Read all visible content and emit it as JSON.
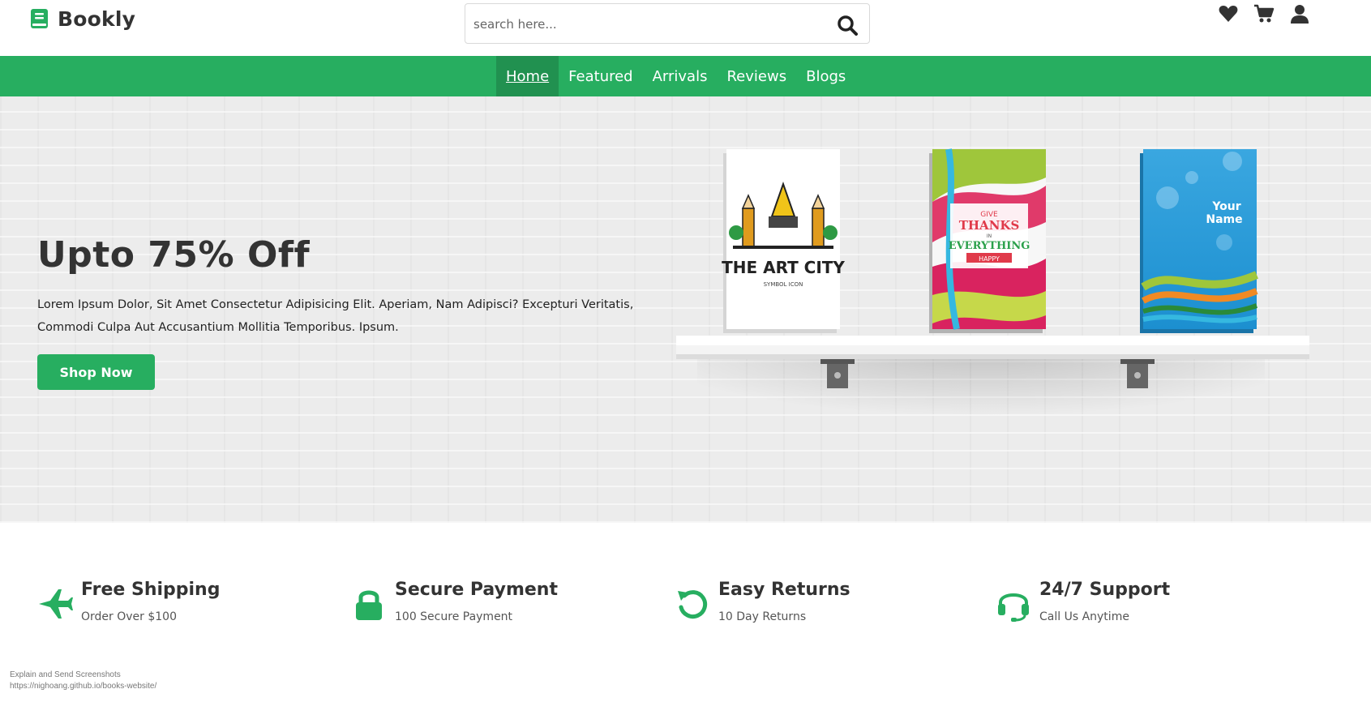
{
  "header": {
    "brand": "Bookly",
    "search_placeholder": "search here...",
    "colors": {
      "accent": "#27ae60",
      "text": "#333333"
    },
    "icons": [
      "heart-icon",
      "cart-icon",
      "user-icon"
    ]
  },
  "nav": {
    "items": [
      {
        "label": "Home",
        "active": true
      },
      {
        "label": "Featured",
        "active": false
      },
      {
        "label": "Arrivals",
        "active": false
      },
      {
        "label": "Reviews",
        "active": false
      },
      {
        "label": "Blogs",
        "active": false
      }
    ]
  },
  "hero": {
    "title": "Upto 75% Off",
    "description": "Lorem Ipsum Dolor, Sit Amet Consectetur Adipisicing Elit. Aperiam, Nam Adipisci? Excepturi Veritatis, Commodi Culpa Aut Accusantium Mollitia Temporibus. Ipsum.",
    "cta": "Shop Now",
    "books": [
      {
        "title": "THE ART CITY",
        "subtitle": "SYMBOL ICON"
      },
      {
        "line1": "GIVE",
        "line2": "THANKS",
        "line3": "IN",
        "line4": "EVERYTHING",
        "line5": "HAPPY"
      },
      {
        "line1": "Your",
        "line2": "Name"
      }
    ]
  },
  "features": [
    {
      "icon": "plane-icon",
      "title": "Free Shipping",
      "subtitle": "Order Over $100"
    },
    {
      "icon": "lock-icon",
      "title": "Secure Payment",
      "subtitle": "100 Secure Payment"
    },
    {
      "icon": "redo-icon",
      "title": "Easy Returns",
      "subtitle": "10 Day Returns"
    },
    {
      "icon": "headset-icon",
      "title": "24/7 Support",
      "subtitle": "Call Us Anytime"
    }
  ],
  "footnote": {
    "line1": "Explain and Send Screenshots",
    "line2": "https://nighoang.github.io/books-website/"
  }
}
